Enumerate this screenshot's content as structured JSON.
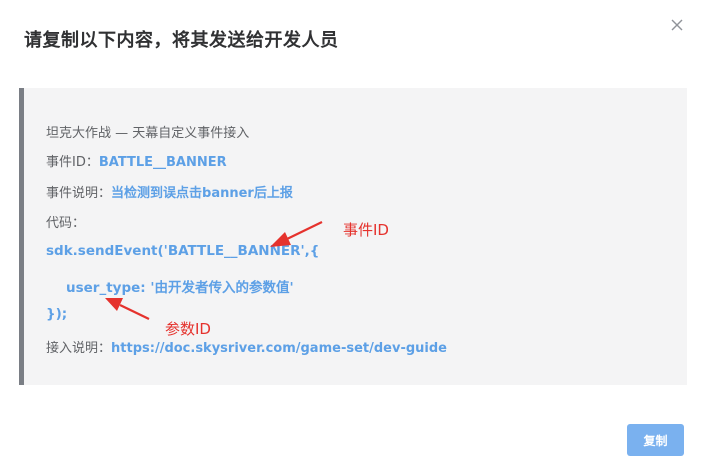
{
  "dialog": {
    "title": "请复制以下内容，将其发送给开发人员",
    "copy_label": "复制"
  },
  "content": {
    "heading": "坦克大作战 — 天幕自定义事件接入",
    "event_id_label": "事件ID：",
    "event_id_value": "BATTLE__BANNER",
    "event_desc_label": "事件说明：",
    "event_desc_value": "当检测到误点击banner后上报",
    "code_label": "代码：",
    "code_line1": "sdk.sendEvent('BATTLE__BANNER',{",
    "code_line2": "user_type: '由开发者传入的参数值'",
    "code_line3": "});",
    "doc_label": "接入说明：",
    "doc_url": "https://doc.skysriver.com/game-set/dev-guide"
  },
  "annotations": {
    "event_id": "事件ID",
    "param_id": "参数ID",
    "color": "#e5322d"
  },
  "colors": {
    "accent": "#5da0e6",
    "button": "#7ab1ef",
    "panel_bg": "#f4f4f5",
    "panel_border": "#7a7e85"
  },
  "icons": {
    "close": "close-icon"
  }
}
